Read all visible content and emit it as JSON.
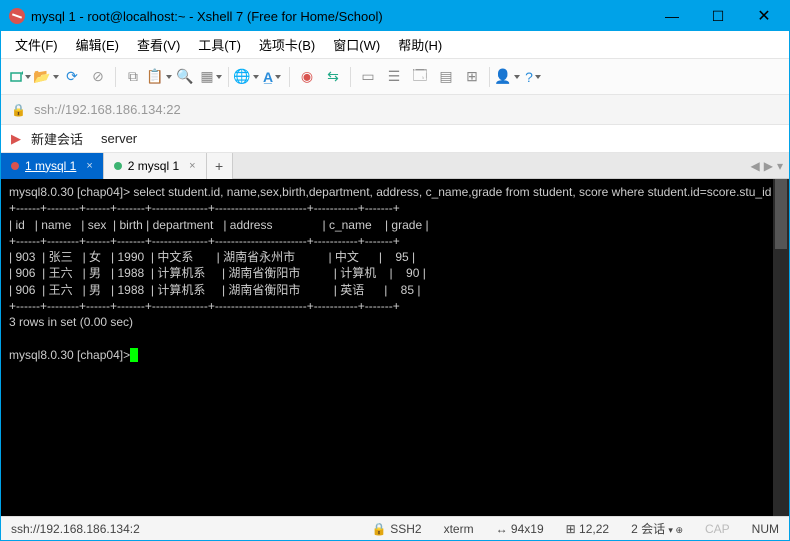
{
  "window": {
    "title": "mysql 1 - root@localhost:~ - Xshell 7 (Free for Home/School)"
  },
  "menu": {
    "file": "文件(F)",
    "edit": "编辑(E)",
    "view": "查看(V)",
    "tools": "工具(T)",
    "tabs": "选项卡(B)",
    "window": "窗口(W)",
    "help": "帮助(H)"
  },
  "address": {
    "url": "ssh://192.168.186.134:22"
  },
  "session_hint": {
    "new": "新建会话",
    "server": "server"
  },
  "tabs": {
    "items": [
      {
        "label": "1 mysql 1"
      },
      {
        "label": "2 mysql 1"
      }
    ],
    "add": "+"
  },
  "terminal": {
    "prompt1": "mysql8.0.30 [chap04]> ",
    "sql": "select student.id, name,sex,birth,department, address, c_name,grade from student, score where student.id=score.stu_id and address like '湖南%' ;",
    "border": "+------+--------+------+-------+--------------+-----------------------+-----------+-------+",
    "header": "| id   | name   | sex  | birth | department   | address               | c_name    | grade |",
    "rows": [
      "| 903  | 张三   | 女   | 1990  | 中文系       | 湖南省永州市          | 中文      |    95 |",
      "| 906  | 王六   | 男   | 1988  | 计算机系     | 湖南省衡阳市          | 计算机    |    90 |",
      "| 906  | 王六   | 男   | 1988  | 计算机系     | 湖南省衡阳市          | 英语      |    85 |"
    ],
    "summary": "3 rows in set (0.00 sec)",
    "prompt2": "mysql8.0.30 [chap04]>"
  },
  "chart_data": {
    "type": "table",
    "columns": [
      "id",
      "name",
      "sex",
      "birth",
      "department",
      "address",
      "c_name",
      "grade"
    ],
    "rows": [
      {
        "id": 903,
        "name": "张三",
        "sex": "女",
        "birth": 1990,
        "department": "中文系",
        "address": "湖南省永州市",
        "c_name": "中文",
        "grade": 95
      },
      {
        "id": 906,
        "name": "王六",
        "sex": "男",
        "birth": 1988,
        "department": "计算机系",
        "address": "湖南省衡阳市",
        "c_name": "计算机",
        "grade": 90
      },
      {
        "id": 906,
        "name": "王六",
        "sex": "男",
        "birth": 1988,
        "department": "计算机系",
        "address": "湖南省衡阳市",
        "c_name": "英语",
        "grade": 85
      }
    ],
    "rows_in_set": 3,
    "elapsed_sec": 0.0
  },
  "status": {
    "addr": "ssh://192.168.186.134:2",
    "proto": "SSH2",
    "term": "xterm",
    "size": "94x19",
    "pos": "12,22",
    "sess": "2 会话",
    "caps": "CAP",
    "num": "NUM"
  }
}
